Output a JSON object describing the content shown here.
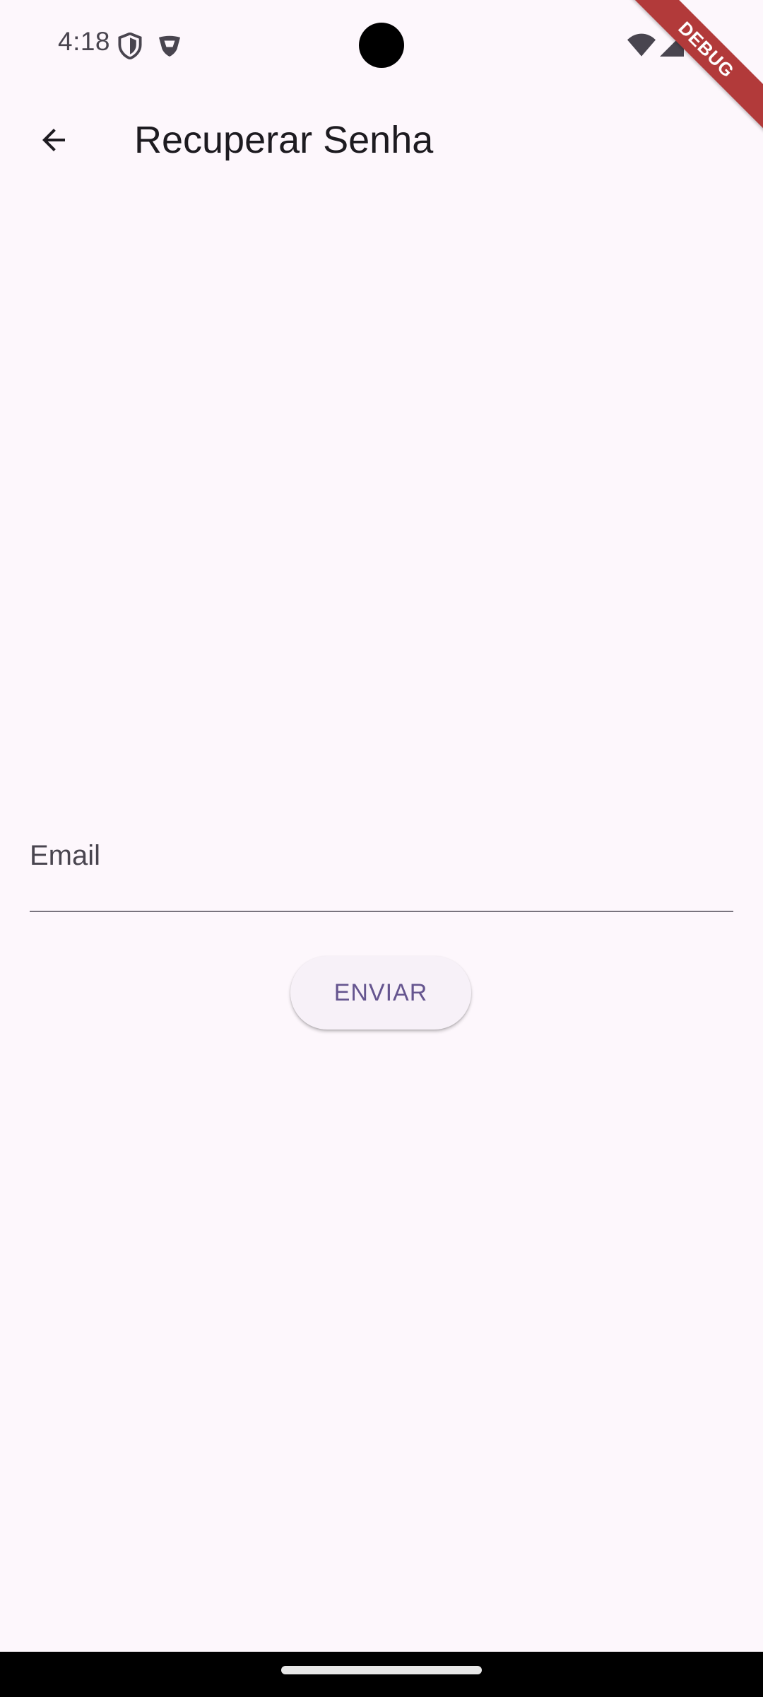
{
  "status_bar": {
    "time": "4:18",
    "icons": [
      "shield-icon",
      "vpn-key-icon",
      "wifi-icon",
      "cell-signal-icon",
      "battery-icon"
    ]
  },
  "debug_banner": {
    "label": "DEBUG",
    "color": "#b23a3a"
  },
  "app_bar": {
    "back_icon": "arrow-back-icon",
    "title": "Recuperar Senha"
  },
  "form": {
    "email": {
      "label": "Email",
      "value": ""
    },
    "submit_label": "ENVIAR"
  },
  "colors": {
    "background": "#fdf7fc",
    "primary": "#65558f",
    "button_surface": "#f7f1f8",
    "on_surface": "#1d1b20",
    "outline": "#79747e"
  }
}
